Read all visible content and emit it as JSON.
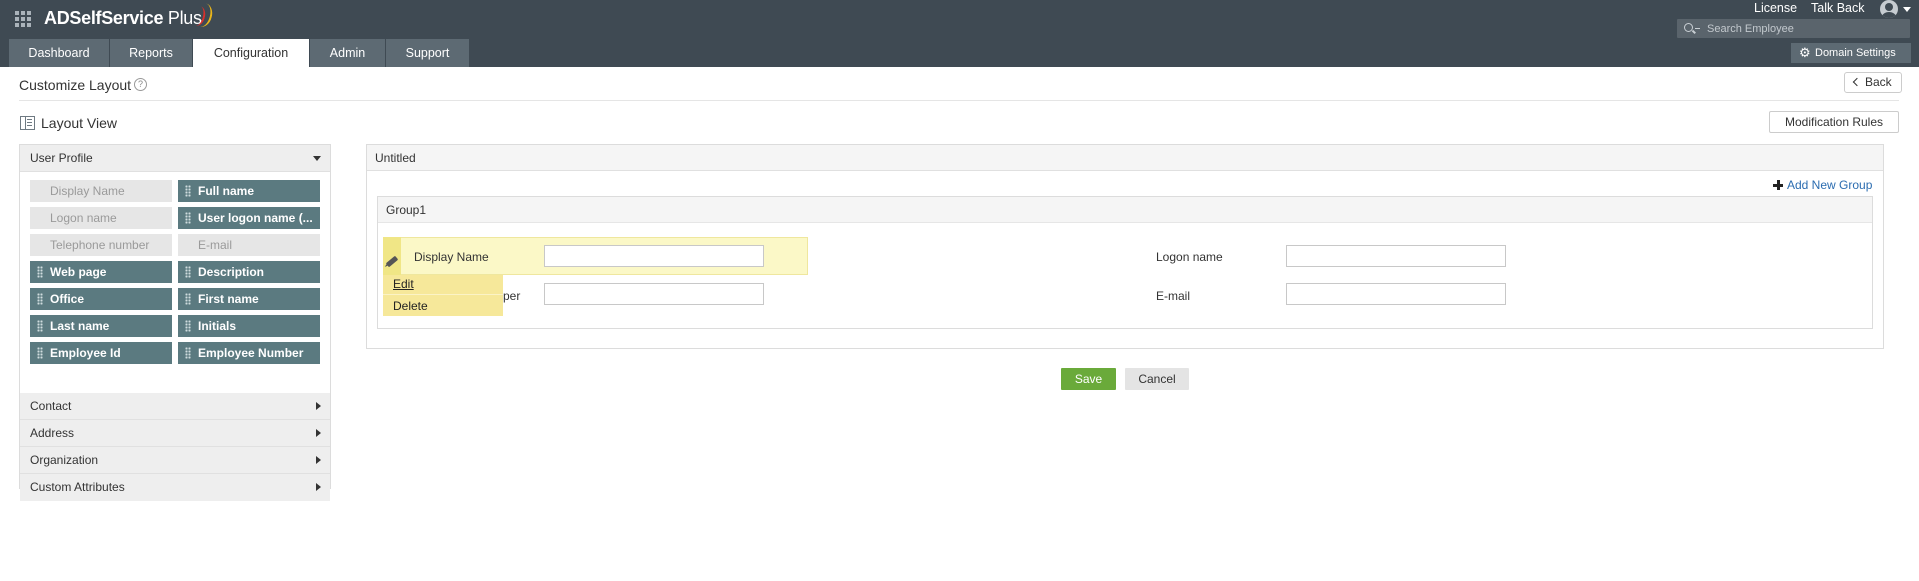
{
  "app": {
    "brand": "ADSelfService",
    "brand_suffix": "Plus"
  },
  "header": {
    "license": "License",
    "talk_back": "Talk Back",
    "search_placeholder": "Search Employee",
    "domain_settings": "Domain Settings"
  },
  "tabs": [
    {
      "label": "Dashboard",
      "active": false
    },
    {
      "label": "Reports",
      "active": false
    },
    {
      "label": "Configuration",
      "active": true
    },
    {
      "label": "Admin",
      "active": false
    },
    {
      "label": "Support",
      "active": false
    }
  ],
  "page": {
    "title": "Customize Layout",
    "back": "Back",
    "layout_view": "Layout View",
    "modification_rules": "Modification Rules"
  },
  "left_panel": {
    "expanded_section": "User Profile",
    "fields": [
      {
        "label": "Display Name",
        "state": "disabled"
      },
      {
        "label": "Full name",
        "state": "enabled"
      },
      {
        "label": "Logon name",
        "state": "disabled"
      },
      {
        "label": "User logon name (...",
        "state": "enabled"
      },
      {
        "label": "Telephone number",
        "state": "disabled"
      },
      {
        "label": "E-mail",
        "state": "disabled"
      },
      {
        "label": "Web page",
        "state": "enabled"
      },
      {
        "label": "Description",
        "state": "enabled"
      },
      {
        "label": "Office",
        "state": "enabled"
      },
      {
        "label": "First name",
        "state": "enabled"
      },
      {
        "label": "Last name",
        "state": "enabled"
      },
      {
        "label": "Initials",
        "state": "enabled"
      },
      {
        "label": "Employee Id",
        "state": "enabled"
      },
      {
        "label": "Employee Number",
        "state": "enabled"
      }
    ],
    "collapsed_sections": [
      "Contact",
      "Address",
      "Organization",
      "Custom Attributes"
    ]
  },
  "main_panel": {
    "title": "Untitled",
    "add_group": "Add New Group",
    "group_title": "Group1",
    "fields": {
      "display_name": "Display Name",
      "telephone_partial": "per",
      "logon_name": "Logon name",
      "email": "E-mail"
    },
    "context_menu": {
      "edit": "Edit",
      "delete": "Delete"
    }
  },
  "actions": {
    "save": "Save",
    "cancel": "Cancel"
  },
  "colors": {
    "topbar": "#3f4a53",
    "tab": "#5d6a73",
    "chip_enabled": "#5b7a80",
    "chip_disabled": "#e6e6e6",
    "save": "#6aaa3a",
    "highlight": "#fbf8c7",
    "menu": "#f6e89a"
  }
}
